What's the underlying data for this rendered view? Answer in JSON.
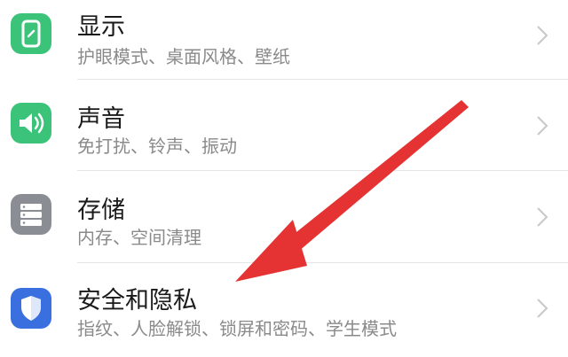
{
  "settings": {
    "items": [
      {
        "title": "显示",
        "subtitle": "护眼模式、桌面风格、壁纸",
        "icon": "display-icon",
        "color": "#3cc37a"
      },
      {
        "title": "声音",
        "subtitle": "免打扰、铃声、振动",
        "icon": "sound-icon",
        "color": "#3cc37a"
      },
      {
        "title": "存储",
        "subtitle": "内存、空间清理",
        "icon": "storage-icon",
        "color": "#8a8d93"
      },
      {
        "title": "安全和隐私",
        "subtitle": "指纹、人脸解锁、锁屏和密码、学生模式",
        "icon": "shield-icon",
        "color": "#3a6fe0"
      }
    ]
  },
  "annotation": {
    "arrow_color": "#e53333",
    "arrow_icon": "red-arrow-icon"
  }
}
